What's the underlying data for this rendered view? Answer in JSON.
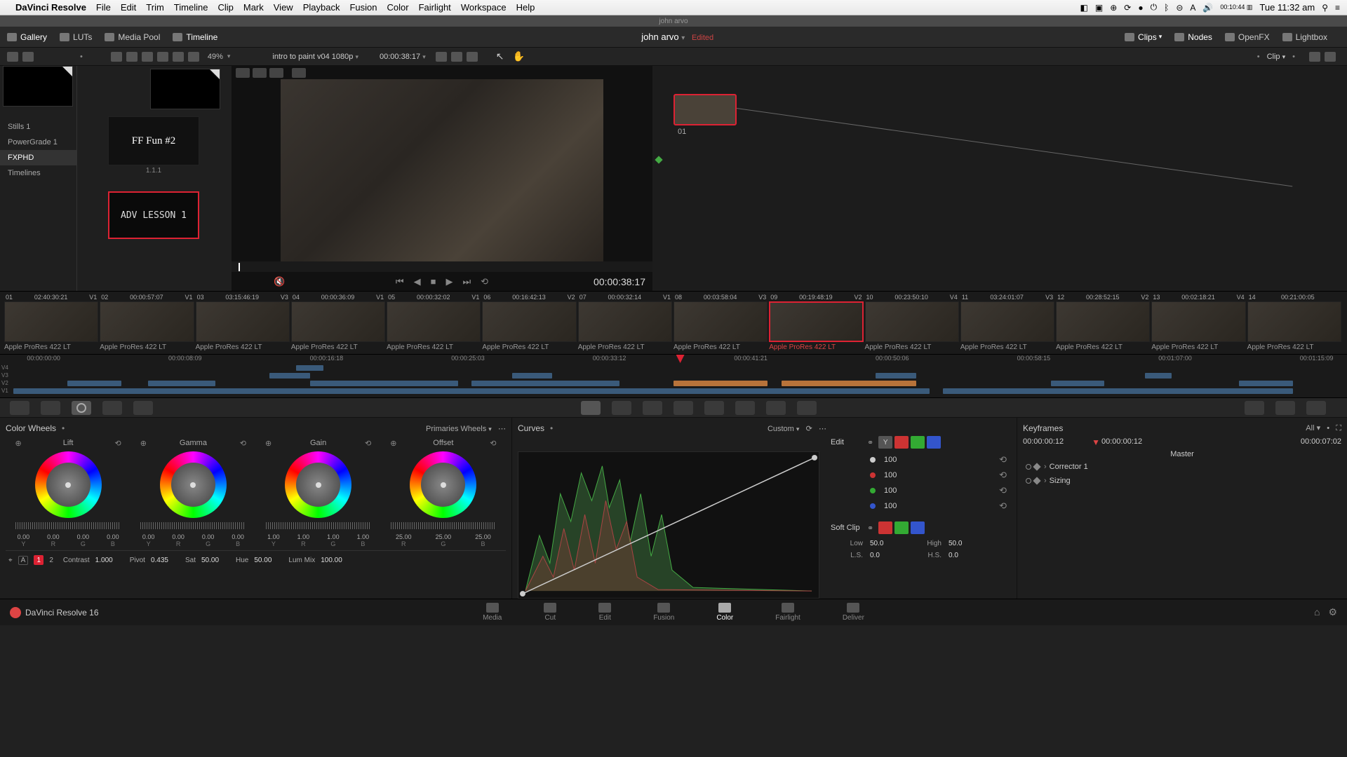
{
  "mac": {
    "app": "DaVinci Resolve",
    "menus": [
      "File",
      "Edit",
      "Trim",
      "Timeline",
      "Clip",
      "Mark",
      "View",
      "Playback",
      "Fusion",
      "Color",
      "Fairlight",
      "Workspace",
      "Help"
    ],
    "battery": "00:10:44",
    "time": "Tue 11:32 am"
  },
  "window_title": "john arvo",
  "toolbar": {
    "gallery": "Gallery",
    "luts": "LUTs",
    "mediapool": "Media Pool",
    "timeline": "Timeline",
    "project": "john arvo",
    "edited": "Edited",
    "clips": "Clips",
    "nodes": "Nodes",
    "openfx": "OpenFX",
    "lightbox": "Lightbox"
  },
  "sec": {
    "zoom": "49%",
    "timeline_name": "intro to paint v04 1080p",
    "tc": "00:00:38:17",
    "clip": "Clip"
  },
  "gallery": {
    "sidebar": [
      "Stills 1",
      "PowerGrade 1",
      "FXPHD",
      "Timelines"
    ],
    "active": 2,
    "still_title": "FF Fun #2",
    "still_code": "1.1.1",
    "adv_label": "ADV LESSON 1"
  },
  "viewer": {
    "tc": "00:00:38:17"
  },
  "nodes": {
    "label": "01"
  },
  "clips": [
    {
      "n": "01",
      "tc": "02:40:30:21",
      "trk": "V1",
      "codec": "Apple ProRes 422 LT"
    },
    {
      "n": "02",
      "tc": "00:00:57:07",
      "trk": "V1",
      "codec": "Apple ProRes 422 LT"
    },
    {
      "n": "03",
      "tc": "03:15:46:19",
      "trk": "V3",
      "codec": "Apple ProRes 422 LT"
    },
    {
      "n": "04",
      "tc": "00:00:36:09",
      "trk": "V1",
      "codec": "Apple ProRes 422 LT"
    },
    {
      "n": "05",
      "tc": "00:00:32:02",
      "trk": "V1",
      "codec": "Apple ProRes 422 LT"
    },
    {
      "n": "06",
      "tc": "00:16:42:13",
      "trk": "V2",
      "codec": "Apple ProRes 422 LT"
    },
    {
      "n": "07",
      "tc": "00:00:32:14",
      "trk": "V1",
      "codec": "Apple ProRes 422 LT"
    },
    {
      "n": "08",
      "tc": "00:03:58:04",
      "trk": "V3",
      "codec": "Apple ProRes 422 LT"
    },
    {
      "n": "09",
      "tc": "00:19:48:19",
      "trk": "V2",
      "codec": "Apple ProRes 422 LT"
    },
    {
      "n": "10",
      "tc": "00:23:50:10",
      "trk": "V4",
      "codec": "Apple ProRes 422 LT"
    },
    {
      "n": "11",
      "tc": "03:24:01:07",
      "trk": "V3",
      "codec": "Apple ProRes 422 LT"
    },
    {
      "n": "12",
      "tc": "00:28:52:15",
      "trk": "V2",
      "codec": "Apple ProRes 422 LT"
    },
    {
      "n": "13",
      "tc": "00:02:18:21",
      "trk": "V4",
      "codec": "Apple ProRes 422 LT"
    },
    {
      "n": "14",
      "tc": "00:21:00:05",
      "trk": "",
      "codec": "Apple ProRes 422 LT"
    }
  ],
  "selected_clip": 8,
  "mini_tl": {
    "ticks": [
      "00:00:00:00",
      "00:00:08:09",
      "00:00:16:18",
      "00:00:25:03",
      "00:00:33:12",
      "00:00:41:21",
      "00:00:50:06",
      "00:00:58:15",
      "00:01:07:00",
      "00:01:15:09"
    ],
    "tracks": [
      "V4",
      "V3",
      "V2",
      "V1"
    ]
  },
  "wheels": {
    "title": "Color Wheels",
    "mode": "Primaries Wheels",
    "items": [
      {
        "name": "Lift",
        "vals": [
          "0.00",
          "0.00",
          "0.00",
          "0.00"
        ],
        "labels": [
          "Y",
          "R",
          "G",
          "B"
        ]
      },
      {
        "name": "Gamma",
        "vals": [
          "0.00",
          "0.00",
          "0.00",
          "0.00"
        ],
        "labels": [
          "Y",
          "R",
          "G",
          "B"
        ]
      },
      {
        "name": "Gain",
        "vals": [
          "1.00",
          "1.00",
          "1.00",
          "1.00"
        ],
        "labels": [
          "Y",
          "R",
          "G",
          "B"
        ]
      },
      {
        "name": "Offset",
        "vals": [
          "25.00",
          "25.00",
          "25.00"
        ],
        "labels": [
          "R",
          "G",
          "B"
        ]
      }
    ],
    "adjust": {
      "page1": "1",
      "page2": "2",
      "contrast_l": "Contrast",
      "contrast": "1.000",
      "pivot_l": "Pivot",
      "pivot": "0.435",
      "sat_l": "Sat",
      "sat": "50.00",
      "hue_l": "Hue",
      "hue": "50.00",
      "lummix_l": "Lum Mix",
      "lummix": "100.00"
    }
  },
  "curves": {
    "title": "Curves",
    "mode": "Custom",
    "edit_l": "Edit",
    "channels": [
      {
        "color": "w",
        "val": "100"
      },
      {
        "color": "r",
        "val": "100"
      },
      {
        "color": "g",
        "val": "100"
      },
      {
        "color": "b",
        "val": "100"
      }
    ],
    "softclip_l": "Soft Clip",
    "softclip": {
      "low_l": "Low",
      "low": "50.0",
      "high_l": "High",
      "high": "50.0",
      "ls_l": "L.S.",
      "ls": "0.0",
      "hs_l": "H.S.",
      "hs": "0.0"
    }
  },
  "keyframes": {
    "title": "Keyframes",
    "all": "All",
    "tc_start": "00:00:00:12",
    "tc_play": "00:00:00:12",
    "tc_end": "00:00:07:02",
    "master": "Master",
    "tracks": [
      "Corrector 1",
      "Sizing"
    ]
  },
  "pages": [
    "Media",
    "Cut",
    "Edit",
    "Fusion",
    "Color",
    "Fairlight",
    "Deliver"
  ],
  "active_page": 4,
  "app_label": "DaVinci Resolve 16"
}
